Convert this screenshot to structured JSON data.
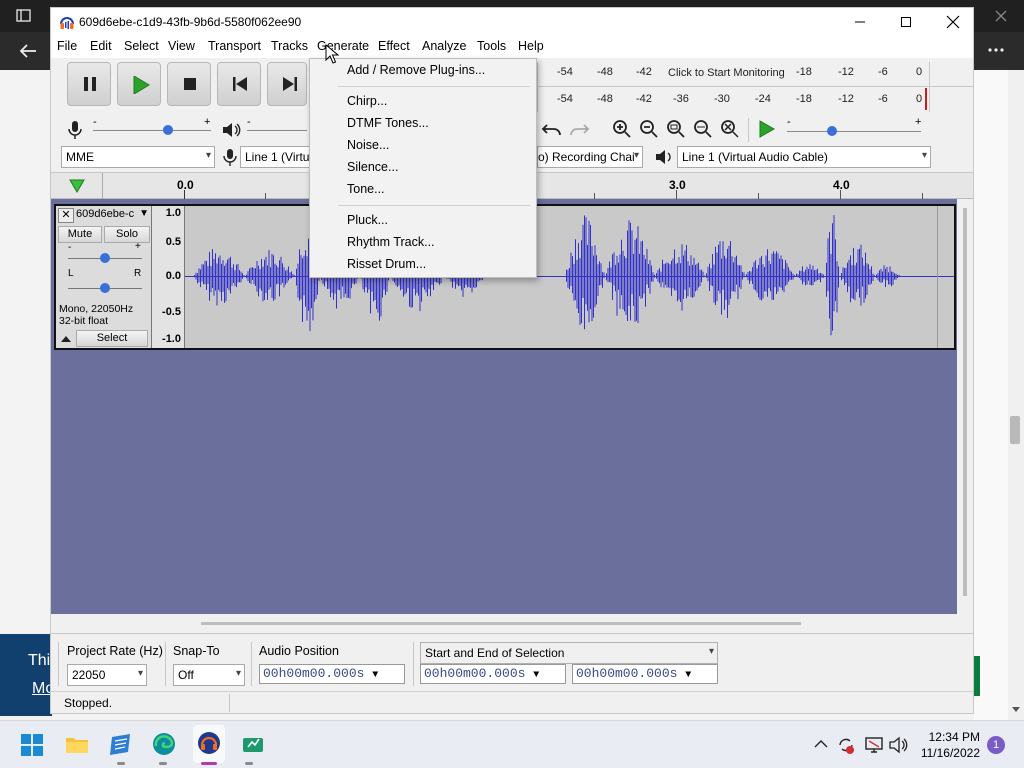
{
  "audacity": {
    "window_title": "609d6ebe-c1d9-43fb-9b6d-5580f062ee90",
    "menus": [
      "File",
      "Edit",
      "Select",
      "View",
      "Transport",
      "Tracks",
      "Generate",
      "Effect",
      "Analyze",
      "Tools",
      "Help"
    ],
    "meters": {
      "record_ticks": [
        "-54",
        "-48",
        "-42",
        "Click to Start Monitoring",
        "-18",
        "-12",
        "-6",
        "0"
      ],
      "play_ticks": [
        "-54",
        "-48",
        "-42",
        "-36",
        "-30",
        "-24",
        "-18",
        "-12",
        "-6",
        "0"
      ]
    },
    "devices": {
      "host": "MME",
      "recording_device": "Line 1 (Virtual",
      "recording_channels": "o) Recording Chai",
      "playback_device": "Line 1 (Virtual Audio Cable)"
    },
    "ruler": {
      "labels": [
        "0.0",
        "3.0",
        "4.0"
      ]
    },
    "track": {
      "name": "609d6ebe-c",
      "mute": "Mute",
      "solo": "Solo",
      "gain_min": "-",
      "gain_max": "+",
      "pan_left": "L",
      "pan_right": "R",
      "info_line1": "Mono, 22050Hz",
      "info_line2": "32-bit float",
      "select": "Select",
      "vruler": [
        "1.0",
        "0.5",
        "0.0",
        "-0.5",
        "-1.0"
      ],
      "waveform_color": "#3232c8"
    },
    "selection_toolbar": {
      "project_rate_label": "Project Rate (Hz)",
      "project_rate": "22050",
      "snap_to_label": "Snap-To",
      "snap_to": "Off",
      "audio_position_label": "Audio Position",
      "selection_mode": "Start and End of Selection",
      "audio_position_time": "00h00m00.000s",
      "start_time": "00h00m00.000s",
      "end_time": "00h00m00.000s"
    },
    "status": "Stopped."
  },
  "generate_menu": {
    "items": [
      "Add / Remove Plug-ins...",
      "Chirp...",
      "DTMF Tones...",
      "Noise...",
      "Silence...",
      "Tone...",
      "Pluck...",
      "Rhythm Track...",
      "Risset Drum..."
    ]
  },
  "background": {
    "link_line1": "Thi",
    "link_line2": "Mo"
  },
  "taskbar": {
    "time": "12:34 PM",
    "date": "11/16/2022",
    "notification_count": "1"
  },
  "colors": {
    "track_bg": "#6a6f9c",
    "accent_play": "#2ba32b",
    "banner": "#11406e"
  }
}
